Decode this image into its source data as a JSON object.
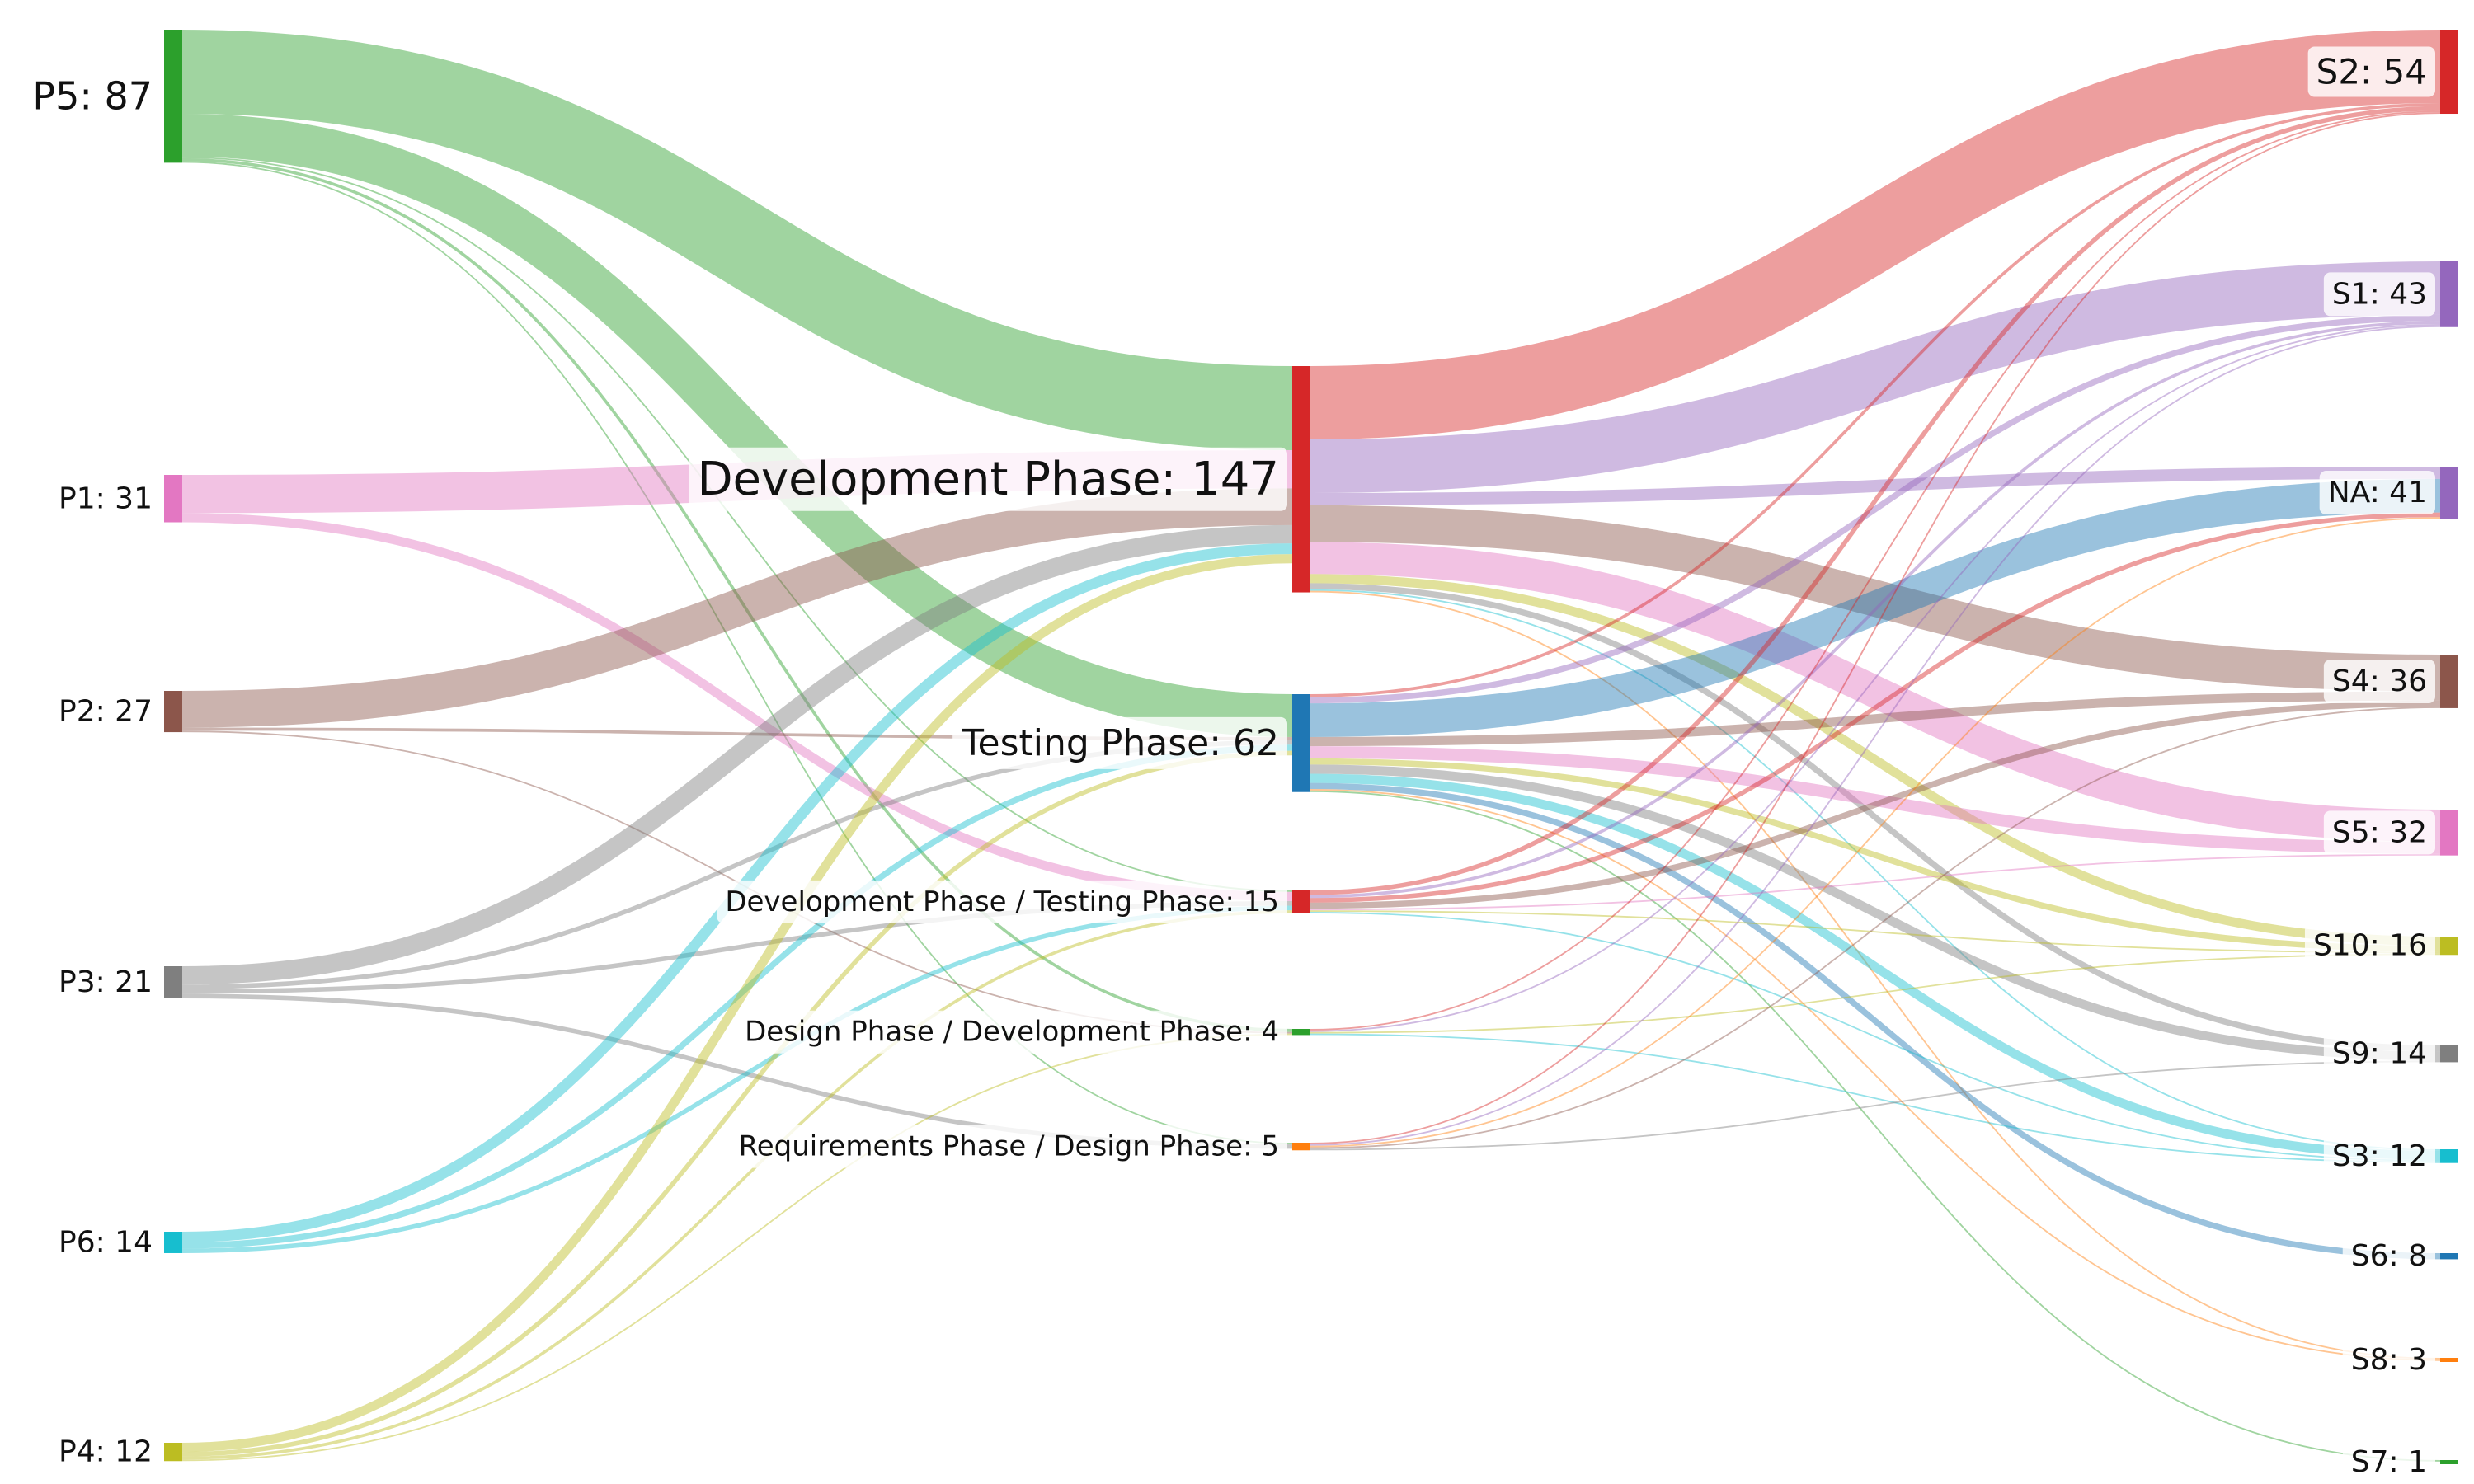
{
  "chart_data": {
    "type": "sankey",
    "nodes": [
      {
        "id": "P5",
        "label": "P5: 87",
        "column": 0,
        "color": "#2ca02c"
      },
      {
        "id": "P1",
        "label": "P1: 31",
        "column": 0,
        "color": "#e377c2"
      },
      {
        "id": "P2",
        "label": "P2: 27",
        "column": 0,
        "color": "#8c564b"
      },
      {
        "id": "P3",
        "label": "P3: 21",
        "column": 0,
        "color": "#7f7f7f"
      },
      {
        "id": "P6",
        "label": "P6: 14",
        "column": 0,
        "color": "#17becf"
      },
      {
        "id": "P4",
        "label": "P4: 12",
        "column": 0,
        "color": "#bcbd22"
      },
      {
        "id": "DEV",
        "label": "Development Phase: 147",
        "column": 1,
        "color": "#d62728"
      },
      {
        "id": "TEST",
        "label": "Testing Phase: 62",
        "column": 1,
        "color": "#1f77b4"
      },
      {
        "id": "DEVTEST",
        "label": "Development Phase / Testing Phase: 15",
        "column": 1,
        "color": "#d62728"
      },
      {
        "id": "DESDEV",
        "label": "Design Phase / Development Phase: 4",
        "column": 1,
        "color": "#2ca02c"
      },
      {
        "id": "REQDES",
        "label": "Requirements Phase / Design Phase: 5",
        "column": 1,
        "color": "#ff7f0e"
      },
      {
        "id": "S2",
        "label": "S2: 54",
        "column": 2,
        "color": "#d62728"
      },
      {
        "id": "S1",
        "label": "S1: 43",
        "column": 2,
        "color": "#9467bd"
      },
      {
        "id": "NA",
        "label": "NA: 41",
        "column": 2,
        "color": "#9467bd"
      },
      {
        "id": "S4",
        "label": "S4: 36",
        "column": 2,
        "color": "#8c564b"
      },
      {
        "id": "S5",
        "label": "S5: 32",
        "column": 2,
        "color": "#e377c2"
      },
      {
        "id": "S10",
        "label": "S10: 16",
        "column": 2,
        "color": "#bcbd22"
      },
      {
        "id": "S9",
        "label": "S9: 14",
        "column": 2,
        "color": "#7f7f7f"
      },
      {
        "id": "S3",
        "label": "S3: 12",
        "column": 2,
        "color": "#17becf"
      },
      {
        "id": "S6",
        "label": "S6: 8",
        "column": 2,
        "color": "#1f77b4"
      },
      {
        "id": "S8",
        "label": "S8: 3",
        "column": 2,
        "color": "#ff7f0e"
      },
      {
        "id": "S7",
        "label": "S7: 1",
        "column": 2,
        "color": "#2ca02c"
      }
    ],
    "links_left": [
      {
        "source": "P5",
        "target": "DEV",
        "value": 55,
        "color": "#2ca02c"
      },
      {
        "source": "P5",
        "target": "TEST",
        "value": 28,
        "color": "#2ca02c"
      },
      {
        "source": "P5",
        "target": "DEVTEST",
        "value": 1,
        "color": "#2ca02c"
      },
      {
        "source": "P5",
        "target": "DESDEV",
        "value": 2,
        "color": "#2ca02c"
      },
      {
        "source": "P5",
        "target": "REQDES",
        "value": 1,
        "color": "#2ca02c"
      },
      {
        "source": "P1",
        "target": "DEV",
        "value": 25,
        "color": "#e377c2"
      },
      {
        "source": "P1",
        "target": "DEVTEST",
        "value": 6,
        "color": "#e377c2"
      },
      {
        "source": "P2",
        "target": "DEV",
        "value": 24,
        "color": "#8c564b"
      },
      {
        "source": "P2",
        "target": "TEST",
        "value": 2,
        "color": "#8c564b"
      },
      {
        "source": "P2",
        "target": "DESDEV",
        "value": 1,
        "color": "#8c564b"
      },
      {
        "source": "P3",
        "target": "DEV",
        "value": 12,
        "color": "#7f7f7f"
      },
      {
        "source": "P3",
        "target": "TEST",
        "value": 3,
        "color": "#7f7f7f"
      },
      {
        "source": "P3",
        "target": "DEVTEST",
        "value": 3,
        "color": "#7f7f7f"
      },
      {
        "source": "P3",
        "target": "REQDES",
        "value": 3,
        "color": "#7f7f7f"
      },
      {
        "source": "P6",
        "target": "DEV",
        "value": 7,
        "color": "#17becf"
      },
      {
        "source": "P6",
        "target": "TEST",
        "value": 4,
        "color": "#17becf"
      },
      {
        "source": "P6",
        "target": "DEVTEST",
        "value": 3,
        "color": "#17becf"
      },
      {
        "source": "P4",
        "target": "DEV",
        "value": 6,
        "color": "#bcbd22"
      },
      {
        "source": "P4",
        "target": "TEST",
        "value": 3,
        "color": "#bcbd22"
      },
      {
        "source": "P4",
        "target": "DEVTEST",
        "value": 2,
        "color": "#bcbd22"
      },
      {
        "source": "P4",
        "target": "DESDEV",
        "value": 1,
        "color": "#bcbd22"
      }
    ],
    "links_right": [
      {
        "source": "DEV",
        "target": "S2",
        "value": 48,
        "color": "#d62728"
      },
      {
        "source": "DEV",
        "target": "S1",
        "value": 35,
        "color": "#9467bd"
      },
      {
        "source": "DEV",
        "target": "NA",
        "value": 8,
        "color": "#9467bd"
      },
      {
        "source": "DEV",
        "target": "S4",
        "value": 24,
        "color": "#8c564b"
      },
      {
        "source": "DEV",
        "target": "S5",
        "value": 21,
        "color": "#e377c2"
      },
      {
        "source": "DEV",
        "target": "S10",
        "value": 6,
        "color": "#bcbd22"
      },
      {
        "source": "DEV",
        "target": "S9",
        "value": 4,
        "color": "#7f7f7f"
      },
      {
        "source": "DEV",
        "target": "S3",
        "value": 1,
        "color": "#17becf"
      },
      {
        "source": "DEV",
        "target": "S8",
        "value": 1,
        "color": "#ff7f0e"
      },
      {
        "source": "TEST",
        "target": "S2",
        "value": 2,
        "color": "#d62728"
      },
      {
        "source": "TEST",
        "target": "S1",
        "value": 4,
        "color": "#9467bd"
      },
      {
        "source": "TEST",
        "target": "NA",
        "value": 22,
        "color": "#1f77b4"
      },
      {
        "source": "TEST",
        "target": "S4",
        "value": 6,
        "color": "#8c564b"
      },
      {
        "source": "TEST",
        "target": "S5",
        "value": 8,
        "color": "#e377c2"
      },
      {
        "source": "TEST",
        "target": "S10",
        "value": 4,
        "color": "#bcbd22"
      },
      {
        "source": "TEST",
        "target": "S9",
        "value": 6,
        "color": "#7f7f7f"
      },
      {
        "source": "TEST",
        "target": "S3",
        "value": 6,
        "color": "#17becf"
      },
      {
        "source": "TEST",
        "target": "S6",
        "value": 4,
        "color": "#1f77b4"
      },
      {
        "source": "TEST",
        "target": "S8",
        "value": 1,
        "color": "#ff7f0e"
      },
      {
        "source": "TEST",
        "target": "S7",
        "value": 1,
        "color": "#2ca02c"
      },
      {
        "source": "DEVTEST",
        "target": "S2",
        "value": 3,
        "color": "#d62728"
      },
      {
        "source": "DEVTEST",
        "target": "S1",
        "value": 2,
        "color": "#9467bd"
      },
      {
        "source": "DEVTEST",
        "target": "NA",
        "value": 3,
        "color": "#d62728"
      },
      {
        "source": "DEVTEST",
        "target": "S4",
        "value": 4,
        "color": "#8c564b"
      },
      {
        "source": "DEVTEST",
        "target": "S5",
        "value": 1,
        "color": "#e377c2"
      },
      {
        "source": "DEVTEST",
        "target": "S10",
        "value": 1,
        "color": "#bcbd22"
      },
      {
        "source": "DEVTEST",
        "target": "S3",
        "value": 1,
        "color": "#17becf"
      },
      {
        "source": "DESDEV",
        "target": "S1",
        "value": 1,
        "color": "#9467bd"
      },
      {
        "source": "DESDEV",
        "target": "S2",
        "value": 1,
        "color": "#d62728"
      },
      {
        "source": "DESDEV",
        "target": "S10",
        "value": 1,
        "color": "#bcbd22"
      },
      {
        "source": "DESDEV",
        "target": "S3",
        "value": 1,
        "color": "#17becf"
      },
      {
        "source": "REQDES",
        "target": "S2",
        "value": 1,
        "color": "#d62728"
      },
      {
        "source": "REQDES",
        "target": "S1",
        "value": 1,
        "color": "#9467bd"
      },
      {
        "source": "REQDES",
        "target": "NA",
        "value": 1,
        "color": "#ff7f0e"
      },
      {
        "source": "REQDES",
        "target": "S4",
        "value": 1,
        "color": "#8c564b"
      },
      {
        "source": "REQDES",
        "target": "S9",
        "value": 1,
        "color": "#7f7f7f"
      }
    ]
  }
}
